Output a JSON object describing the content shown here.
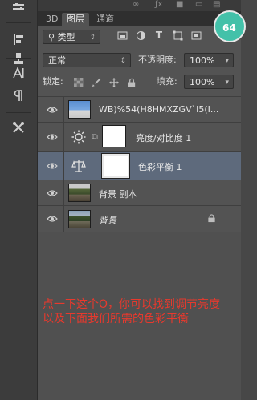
{
  "tabs": [
    {
      "label": "3D"
    },
    {
      "label": "图层"
    },
    {
      "label": "通道"
    }
  ],
  "badge": {
    "text": "64"
  },
  "filter": {
    "kind_label": "类型"
  },
  "blend": {
    "mode": "正常",
    "opacity_label": "不透明度:",
    "opacity_value": "100%",
    "lock_label": "锁定:",
    "fill_label": "填充:",
    "fill_value": "100%"
  },
  "layers": [
    {
      "name": "WB)%54(H8HMXZGV`I5(I...",
      "type": "image",
      "visible": true
    },
    {
      "name": "亮度/对比度 1",
      "type": "adjustment",
      "adjustment_icon": "sun-icon",
      "visible": true
    },
    {
      "name": "色彩平衡 1",
      "type": "adjustment",
      "adjustment_icon": "balance-icon",
      "visible": true,
      "selected": true
    },
    {
      "name": "背景 副本",
      "type": "image",
      "visible": true
    },
    {
      "name": "背景",
      "type": "image",
      "visible": true,
      "locked": true
    }
  ],
  "annotation": {
    "line1": "点一下这个O，你可以找到调节亮度",
    "line2": "以及下面我们所需的色彩平衡"
  },
  "colors": {
    "panel_bg": "#535353",
    "selected_bg": "#5e6a7c",
    "badge_bg": "#43c1a9",
    "annotation_text": "#e8392d"
  }
}
